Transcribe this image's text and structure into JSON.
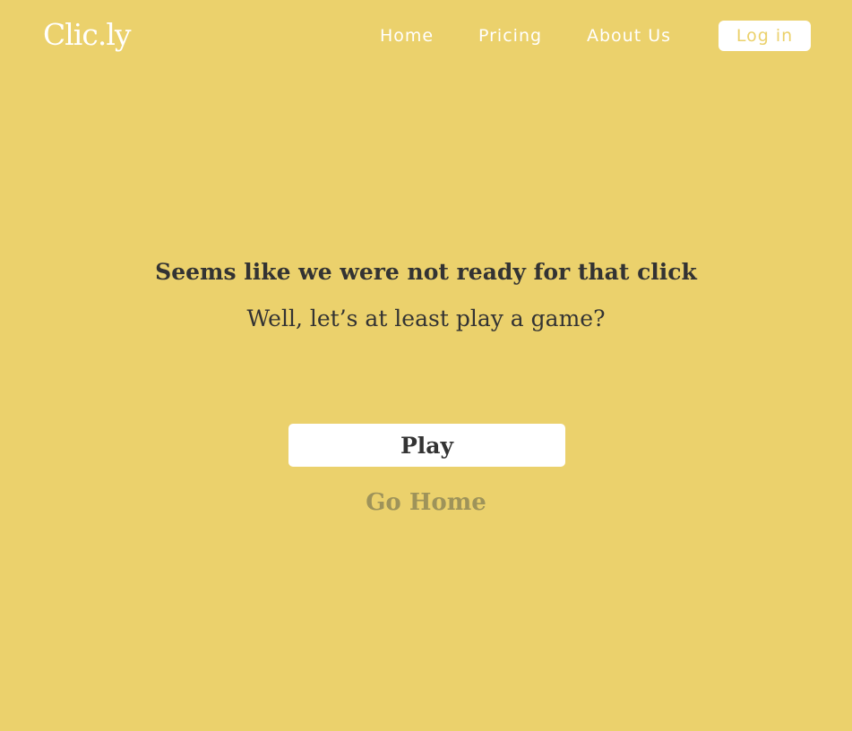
{
  "colors": {
    "background": "#ebd16c",
    "text_dark": "#333333",
    "text_muted": "#9e935a",
    "white": "#ffffff"
  },
  "navbar": {
    "logo": "Clic.ly",
    "links": [
      {
        "label": "Home"
      },
      {
        "label": "Pricing"
      },
      {
        "label": "About Us"
      }
    ],
    "login_label": "Log in"
  },
  "main": {
    "title": "Seems like we were not ready for that click",
    "subtitle": "Well, let’s at least play a game?",
    "play_label": "Play",
    "go_home_label": "Go Home"
  }
}
